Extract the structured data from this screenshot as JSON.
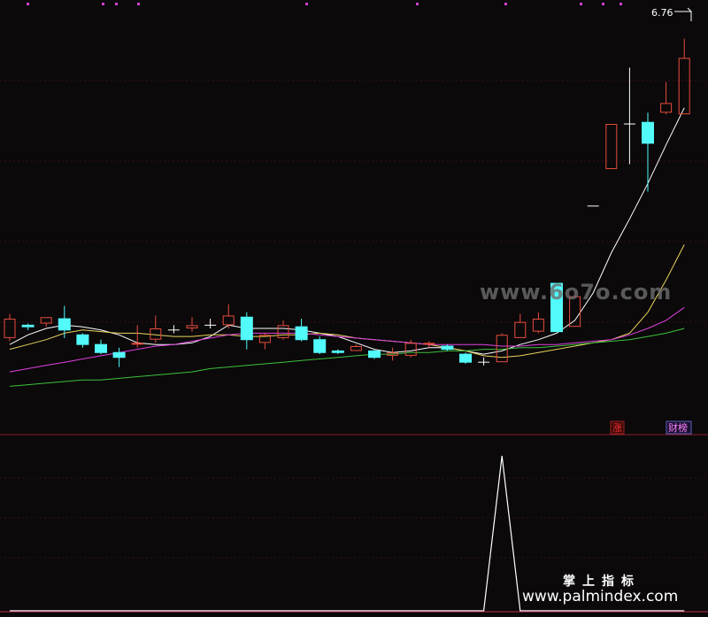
{
  "chart_data": {
    "type": "candlestick",
    "last_price_label": "6.76",
    "indicator_tags": [
      {
        "id": "zhang",
        "label": "涨",
        "color": "#ff3030"
      },
      {
        "id": "caibang",
        "label": "财榜",
        "color": "#ff80ff"
      }
    ],
    "colors": {
      "up": "#e84c3d",
      "down": "#52fafa",
      "ma5": "#ffffff",
      "ma10": "#e8d35a",
      "ma20": "#e040e0",
      "ma60": "#3cc03c",
      "grid": "#3a0f14",
      "divider": "#8a2028",
      "signal": "#ffffff"
    },
    "candles": [
      {
        "o": 4.9,
        "h": 5.05,
        "l": 4.88,
        "c": 5.02
      },
      {
        "o": 4.98,
        "h": 4.99,
        "l": 4.95,
        "c": 4.97
      },
      {
        "o": 4.99,
        "h": 5.03,
        "l": 4.97,
        "c": 5.03
      },
      {
        "o": 5.02,
        "h": 5.1,
        "l": 4.9,
        "c": 4.95
      },
      {
        "o": 4.92,
        "h": 4.93,
        "l": 4.84,
        "c": 4.86
      },
      {
        "o": 4.86,
        "h": 4.89,
        "l": 4.8,
        "c": 4.81
      },
      {
        "o": 4.81,
        "h": 4.84,
        "l": 4.72,
        "c": 4.78
      },
      {
        "o": 4.86,
        "h": 4.98,
        "l": 4.84,
        "c": 4.87
      },
      {
        "o": 4.89,
        "h": 5.04,
        "l": 4.87,
        "c": 4.96
      },
      {
        "o": 4.95,
        "h": 4.98,
        "l": 4.93,
        "c": 4.95
      },
      {
        "o": 4.96,
        "h": 5.03,
        "l": 4.94,
        "c": 4.98
      },
      {
        "o": 4.98,
        "h": 5.02,
        "l": 4.96,
        "c": 4.98
      },
      {
        "o": 4.98,
        "h": 5.11,
        "l": 4.96,
        "c": 5.04
      },
      {
        "o": 5.03,
        "h": 5.06,
        "l": 4.83,
        "c": 4.89
      },
      {
        "o": 4.87,
        "h": 4.93,
        "l": 4.83,
        "c": 4.92
      },
      {
        "o": 4.9,
        "h": 5.01,
        "l": 4.89,
        "c": 4.98
      },
      {
        "o": 4.97,
        "h": 5.02,
        "l": 4.88,
        "c": 4.89
      },
      {
        "o": 4.89,
        "h": 4.91,
        "l": 4.8,
        "c": 4.81
      },
      {
        "o": 4.82,
        "h": 4.83,
        "l": 4.8,
        "c": 4.81
      },
      {
        "o": 4.82,
        "h": 4.86,
        "l": 4.82,
        "c": 4.85
      },
      {
        "o": 4.82,
        "h": 4.83,
        "l": 4.77,
        "c": 4.78
      },
      {
        "o": 4.79,
        "h": 4.84,
        "l": 4.76,
        "c": 4.81
      },
      {
        "o": 4.79,
        "h": 4.89,
        "l": 4.78,
        "c": 4.87
      },
      {
        "o": 4.86,
        "h": 4.88,
        "l": 4.84,
        "c": 4.87
      },
      {
        "o": 4.85,
        "h": 4.86,
        "l": 4.82,
        "c": 4.83
      },
      {
        "o": 4.8,
        "h": 4.81,
        "l": 4.74,
        "c": 4.75
      },
      {
        "o": 4.75,
        "h": 4.78,
        "l": 4.73,
        "c": 4.75
      },
      {
        "o": 4.75,
        "h": 4.93,
        "l": 4.75,
        "c": 4.92
      },
      {
        "o": 4.9,
        "h": 5.05,
        "l": 4.9,
        "c": 5.0
      },
      {
        "o": 4.94,
        "h": 5.06,
        "l": 4.93,
        "c": 5.02
      },
      {
        "o": 5.24,
        "h": 5.24,
        "l": 4.94,
        "c": 4.94
      },
      {
        "o": 4.97,
        "h": 5.16,
        "l": 4.97,
        "c": 5.16
      },
      {
        "o": 5.72,
        "h": 5.72,
        "l": 5.72,
        "c": 5.72
      },
      {
        "o": 5.95,
        "h": 6.23,
        "l": 5.95,
        "c": 6.23
      },
      {
        "o": 6.23,
        "h": 6.58,
        "l": 5.98,
        "c": 6.23
      },
      {
        "o": 6.24,
        "h": 6.3,
        "l": 5.81,
        "c": 6.11
      },
      {
        "o": 6.3,
        "h": 6.49,
        "l": 6.29,
        "c": 6.36
      },
      {
        "o": 6.29,
        "h": 6.76,
        "l": 6.29,
        "c": 6.64
      }
    ],
    "ma": [
      {
        "period": 5,
        "color_key": "ma5",
        "values": [
          4.86,
          4.92,
          4.96,
          4.98,
          4.97,
          4.95,
          4.92,
          4.87,
          4.86,
          4.86,
          4.87,
          4.91,
          4.98,
          4.96,
          4.96,
          4.96,
          4.95,
          4.93,
          4.91,
          4.87,
          4.83,
          4.81,
          4.82,
          4.84,
          4.84,
          4.82,
          4.8,
          4.82,
          4.86,
          4.89,
          4.93,
          5.01,
          5.18,
          5.43,
          5.64,
          5.86,
          6.1,
          6.33
        ]
      },
      {
        "period": 10,
        "color_key": "ma10",
        "values": [
          4.83,
          4.86,
          4.89,
          4.93,
          4.95,
          4.94,
          4.93,
          4.93,
          4.92,
          4.91,
          4.91,
          4.92,
          4.92,
          4.91,
          4.91,
          4.92,
          4.92,
          4.93,
          4.92,
          4.9,
          4.89,
          4.88,
          4.87,
          4.86,
          4.84,
          4.82,
          4.79,
          4.78,
          4.79,
          4.81,
          4.83,
          4.85,
          4.87,
          4.89,
          4.93,
          5.06,
          5.26,
          5.48
        ]
      },
      {
        "period": 20,
        "color_key": "ma20",
        "values": [
          4.69,
          4.71,
          4.73,
          4.75,
          4.77,
          4.79,
          4.81,
          4.83,
          4.85,
          4.86,
          4.88,
          4.9,
          4.92,
          4.93,
          4.93,
          4.93,
          4.93,
          4.92,
          4.91,
          4.9,
          4.89,
          4.88,
          4.87,
          4.86,
          4.86,
          4.86,
          4.86,
          4.85,
          4.85,
          4.86,
          4.86,
          4.87,
          4.88,
          4.89,
          4.92,
          4.96,
          5.01,
          5.09
        ]
      },
      {
        "period": 60,
        "color_key": "ma60",
        "values": [
          4.6,
          4.61,
          4.62,
          4.63,
          4.64,
          4.64,
          4.65,
          4.66,
          4.67,
          4.68,
          4.69,
          4.71,
          4.72,
          4.73,
          4.74,
          4.75,
          4.76,
          4.77,
          4.78,
          4.79,
          4.8,
          4.8,
          4.81,
          4.81,
          4.82,
          4.82,
          4.83,
          4.83,
          4.84,
          4.84,
          4.85,
          4.86,
          4.87,
          4.88,
          4.89,
          4.91,
          4.93,
          4.96
        ]
      }
    ],
    "ylim": [
      4.3,
      7.0
    ],
    "indicator": {
      "ylim": [
        0,
        1
      ],
      "values": [
        0,
        0,
        0,
        0,
        0,
        0,
        0,
        0,
        0,
        0,
        0,
        0,
        0,
        0,
        0,
        0,
        0,
        0,
        0,
        0,
        0,
        0,
        0,
        0,
        0,
        0,
        0,
        1,
        0,
        0,
        0,
        0,
        0,
        0,
        0,
        0,
        0,
        0
      ]
    }
  },
  "watermarks": {
    "site": "www.6o7o.com",
    "cn": "掌上指标",
    "url": "www.palmindex.com"
  }
}
